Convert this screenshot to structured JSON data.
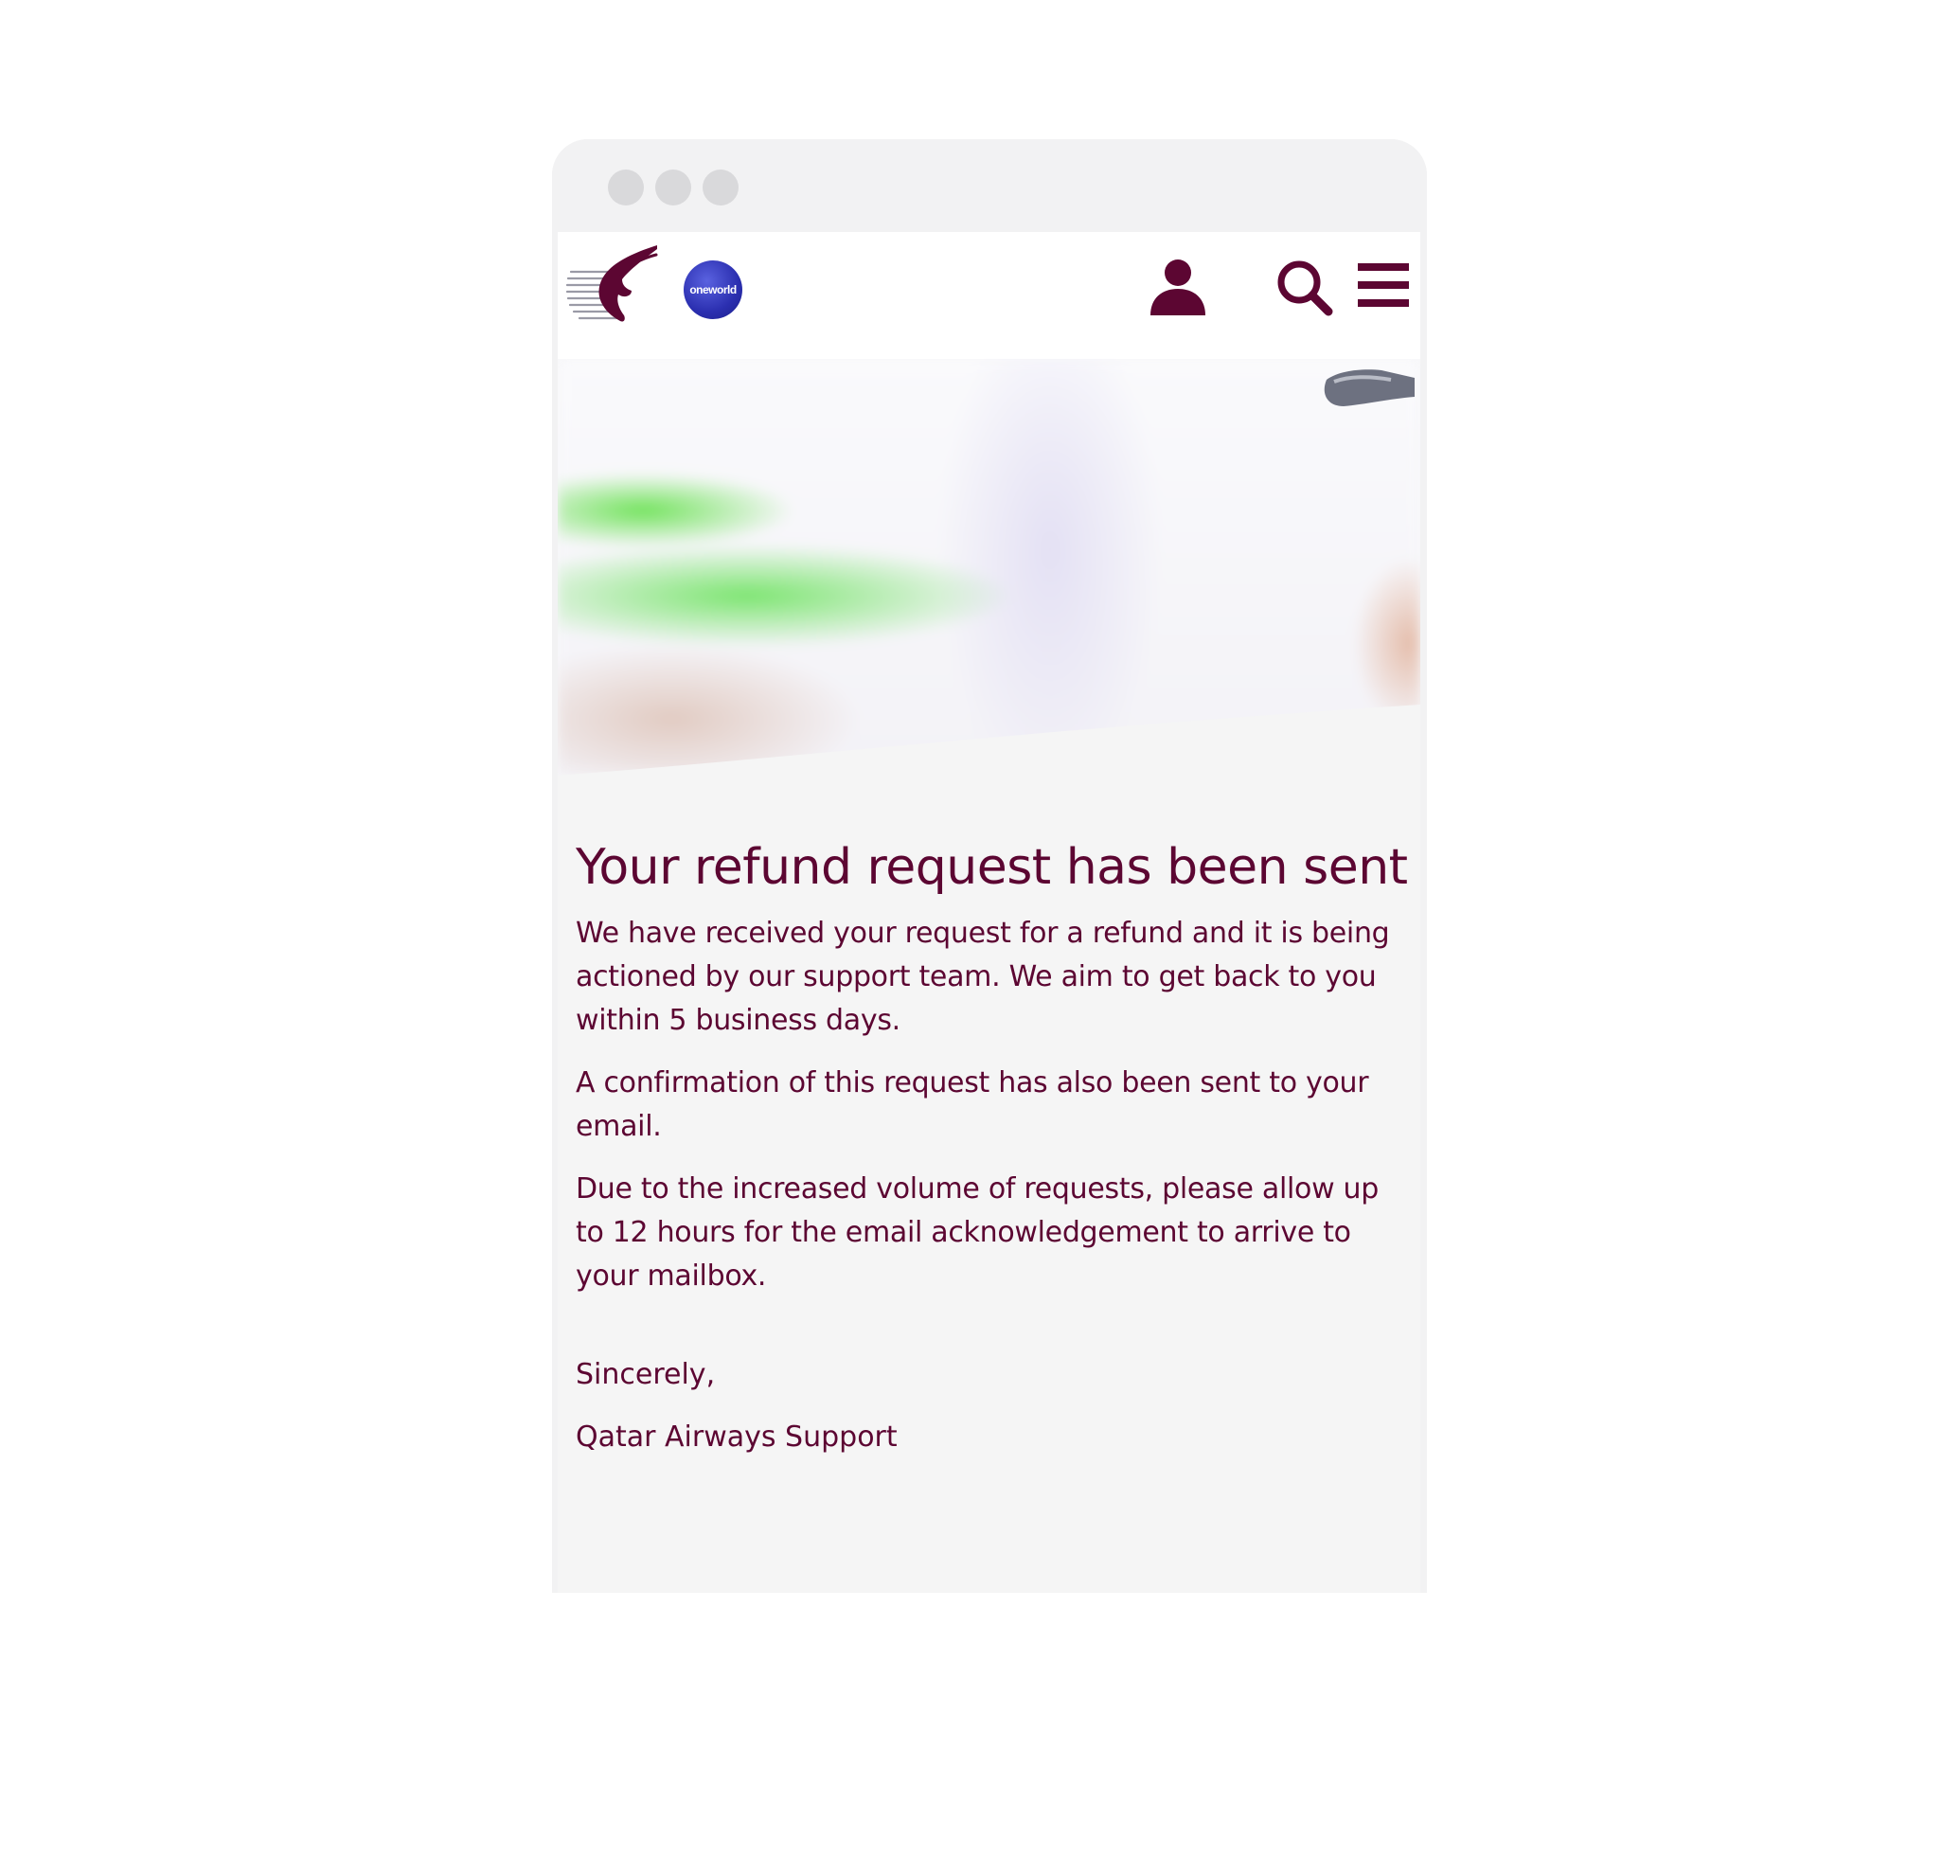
{
  "header": {
    "oneworld_logo_text": "oneworld",
    "icons": [
      "qatar-airways-logo",
      "oneworld-logo",
      "user-icon",
      "search-icon",
      "menu-icon"
    ]
  },
  "message": {
    "title": "Your refund request has been sent",
    "paragraphs": [
      "We have received your request for a refund and it is being actioned by our support team. We aim to get back to you within 5 business days.",
      "A confirmation of this request has also been sent to your email.",
      "Due to the increased volume of requests, please allow up to 12 hours for the email acknowledgement to arrive to your mailbox."
    ],
    "signoff": "Sincerely,",
    "signature": "Qatar Airways Support"
  },
  "colors": {
    "brand": "#5c0632",
    "background": "#f5f5f5",
    "frame": "#f2f2f3",
    "oneworld": "#2b2fb0"
  }
}
